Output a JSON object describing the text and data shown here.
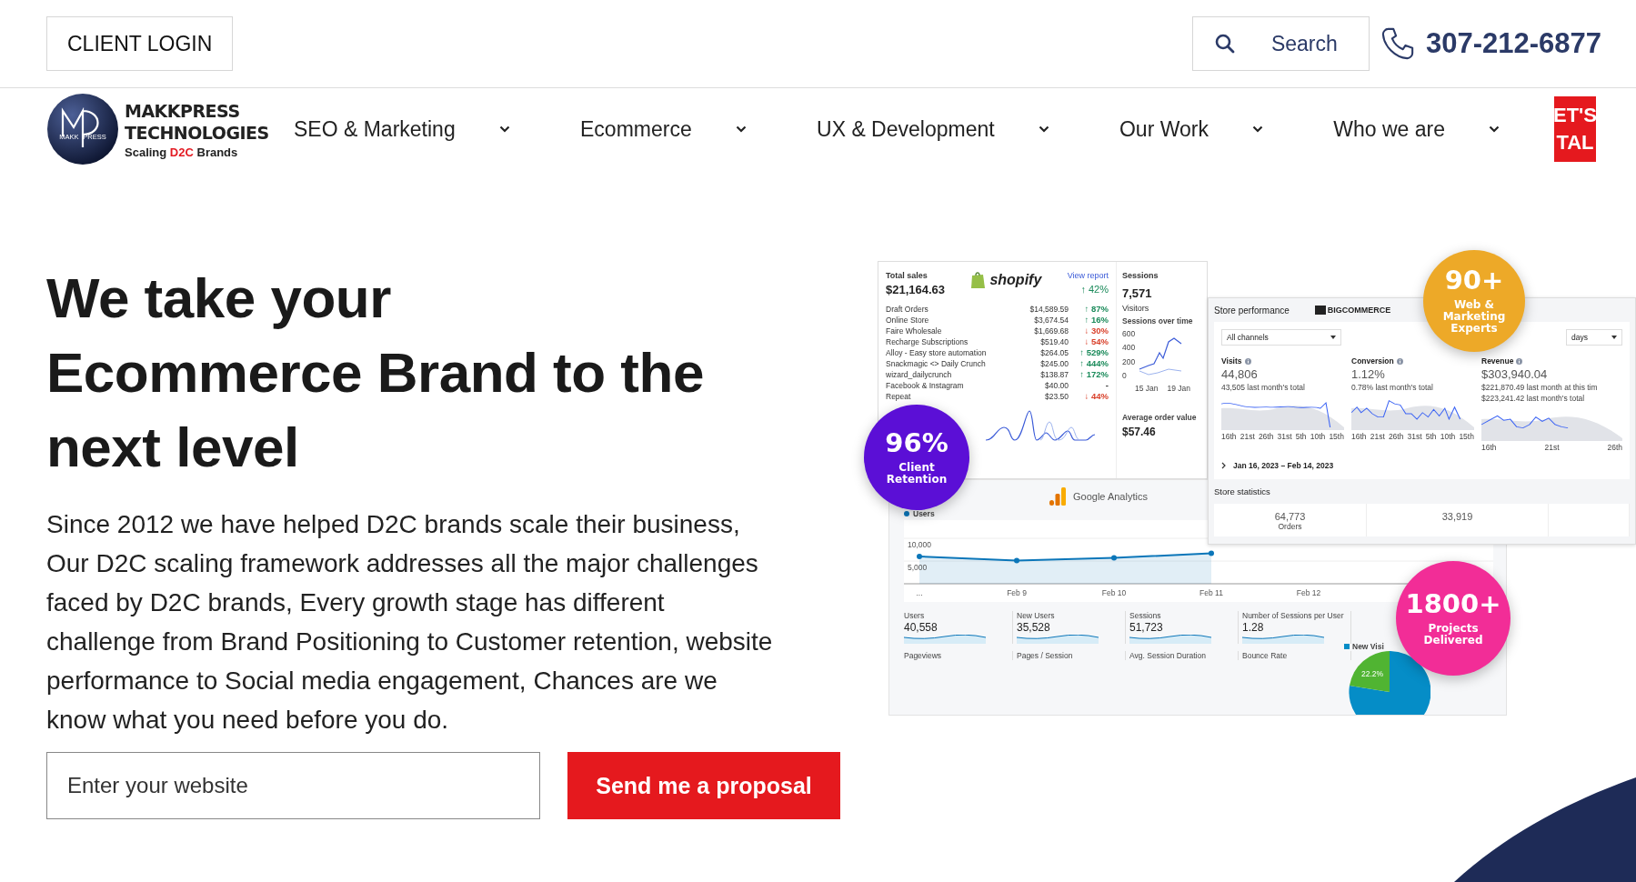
{
  "top_bar": {
    "client_login": "CLIENT LOGIN",
    "search": {
      "placeholder": "Search"
    },
    "phone": "307-212-6877"
  },
  "nav": {
    "logo": {
      "mark_left": "MAKK",
      "mark_right": "PRESS",
      "name_1": "MAKKPRESS",
      "name_2": "TECHNOLOGIES",
      "tagline_before": "Scaling",
      "tagline_highlight": "D2C",
      "tagline_after": "Brands"
    },
    "items": [
      {
        "label": "SEO & Marketing"
      },
      {
        "label": "Ecommerce"
      },
      {
        "label": "UX & Development"
      },
      {
        "label": "Our Work"
      },
      {
        "label": "Who we are"
      }
    ],
    "cta_lines": [
      "ET'S",
      "TAL"
    ]
  },
  "hero": {
    "headline_lines": [
      "We take your",
      "Ecommerce Brand to the",
      "next level"
    ],
    "body": "Since 2012 we have helped D2C brands scale their business, Our D2C scaling framework addresses all the major challenges faced by D2C brands, Every growth stage has different challenge from Brand Positioning to Customer retention, website performance to Social media engagement, Chances are we know what you need before you do.",
    "website_field": {
      "placeholder": "Enter your website"
    },
    "submit": "Send me a proposal"
  },
  "collage": {
    "shopify": {
      "brand": "shopify",
      "title": "Total sales",
      "amount": "$21,164.63",
      "link": "View report",
      "change": "↑ 42%",
      "rows": [
        {
          "name": "Draft Orders",
          "amount": "$14,589.59",
          "change": "↑ 87%",
          "color": "#1a8a5a"
        },
        {
          "name": "Online Store",
          "amount": "$3,674.54",
          "change": "↑ 16%",
          "color": "#1a8a5a"
        },
        {
          "name": "Faire Wholesale",
          "amount": "$1,669.68",
          "change": "↓ 30%",
          "color": "#d9412b"
        },
        {
          "name": "Recharge Subscriptions",
          "amount": "$519.40",
          "change": "↓ 54%",
          "color": "#d9412b"
        },
        {
          "name": "Alloy - Easy store automation",
          "amount": "$264.05",
          "change": "↑ 529%",
          "color": "#1a8a5a"
        },
        {
          "name": "Snackmagic <> Daily Crunch",
          "amount": "$245.00",
          "change": "↑ 444%",
          "color": "#1a8a5a"
        },
        {
          "name": "wizard_dailycrunch",
          "amount": "$138.87",
          "change": "↑ 172%",
          "color": "#1a8a5a"
        },
        {
          "name": "Facebook & Instagram",
          "amount": "$40.00",
          "change": "-"
        },
        {
          "name": "Repeat",
          "amount": "$23.50",
          "change": "↓ 44%",
          "color": "#d9412b"
        }
      ]
    },
    "sessions": {
      "title": "Sessions",
      "value": "7,571",
      "label": "Visitors",
      "chart_title": "Sessions over time",
      "y_ticks": [
        "600",
        "400",
        "200",
        "0"
      ],
      "x_labels": [
        "15 Jan",
        "19 Jan"
      ],
      "aov_title": "Average order value",
      "aov_value": "$57.46"
    },
    "bigcommerce": {
      "title": "Store performance",
      "brand": "BIGCOMMERCE",
      "channel_select": "All channels",
      "period_select": "days",
      "metrics": [
        {
          "label": "Visits",
          "value": "44,806",
          "notes": [
            "43,505 last month's total"
          ],
          "x_labels": [
            "16th",
            "21st",
            "26th",
            "31st",
            "5th",
            "10th",
            "15th"
          ]
        },
        {
          "label": "Conversion",
          "value": "1.12%",
          "notes": [
            "0.78% last month's total"
          ],
          "x_labels": [
            "16th",
            "21st",
            "26th",
            "31st",
            "5th",
            "10th",
            "15th"
          ]
        },
        {
          "label": "Revenue",
          "value": "$303,940.04",
          "notes": [
            "$221,870.49 last month at this tim",
            "$223,241.42 last month's total"
          ],
          "x_labels": [
            "16th",
            "21st",
            "26th"
          ]
        }
      ],
      "date_range": "Jan 16, 2023 – Feb 14, 2023",
      "stats_title": "Store statistics",
      "stats": [
        {
          "value": "64,773",
          "label": "Orders"
        },
        {
          "value": "33,919"
        }
      ]
    },
    "analytics": {
      "brand": "Google Analytics",
      "chart_data": {
        "type": "area",
        "categories": [
          "...",
          "Feb 9",
          "Feb 10",
          "Feb 11",
          "Feb 12"
        ],
        "series": [
          {
            "name": "Users",
            "color": "#0b76b9",
            "values": [
              6000,
              5100,
              5700,
              6700,
              null
            ]
          }
        ],
        "ylim": [
          0,
          14000
        ],
        "yticks": [
          {
            "value": 10000,
            "label": "10,000"
          },
          {
            "value": 5000,
            "label": "5,000"
          }
        ]
      },
      "metrics": [
        {
          "label": "Users",
          "value": "40,558"
        },
        {
          "label": "New Users",
          "value": "35,528"
        },
        {
          "label": "Sessions",
          "value": "51,723"
        },
        {
          "label": "Number of Sessions per User",
          "value": "1.28"
        }
      ],
      "metrics_2": [
        "Pageviews",
        "Pages / Session",
        "Avg. Session Duration",
        "Bounce Rate"
      ],
      "pie_legend": "New Visi",
      "pie_label": "22.2%"
    },
    "badges": [
      {
        "value": "96%",
        "caption": "Client Retention",
        "color": "#5b0fd6"
      },
      {
        "value": "90+",
        "caption": "Web & Marketing Experts",
        "color": "#eda928"
      },
      {
        "value": "1800+",
        "caption": "Projects Delivered",
        "color": "#f22d97"
      }
    ]
  }
}
